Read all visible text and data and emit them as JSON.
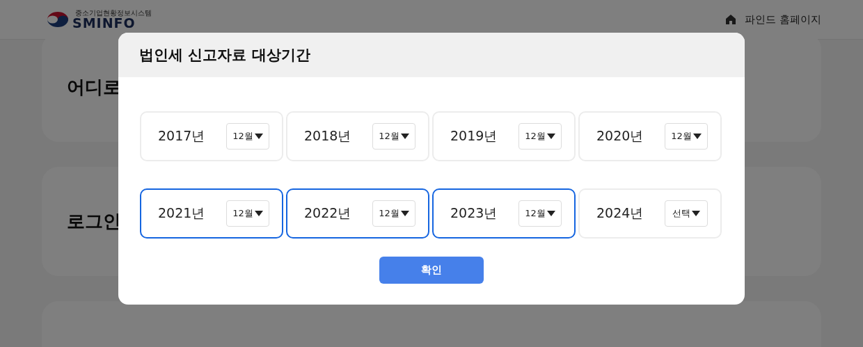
{
  "header": {
    "logo_subtitle": "중소기업현황정보시스템",
    "logo_text": "SMINFO",
    "home_link": "파인드 홈페이지"
  },
  "background_cards": [
    {
      "kind": "titled",
      "title": "어디로"
    },
    {
      "kind": "titled",
      "title": "로그인"
    },
    {
      "kind": "blank"
    }
  ],
  "dialog": {
    "title": "법인세 신고자료 대상기간",
    "periods": [
      {
        "year": "2017년",
        "month": "12월",
        "selected": false
      },
      {
        "year": "2018년",
        "month": "12월",
        "selected": false
      },
      {
        "year": "2019년",
        "month": "12월",
        "selected": false
      },
      {
        "year": "2020년",
        "month": "12월",
        "selected": false
      },
      {
        "year": "2021년",
        "month": "12월",
        "selected": true
      },
      {
        "year": "2022년",
        "month": "12월",
        "selected": true
      },
      {
        "year": "2023년",
        "month": "12월",
        "selected": true
      },
      {
        "year": "2024년",
        "month": "선택",
        "selected": false
      }
    ],
    "confirm_button": "확인"
  }
}
